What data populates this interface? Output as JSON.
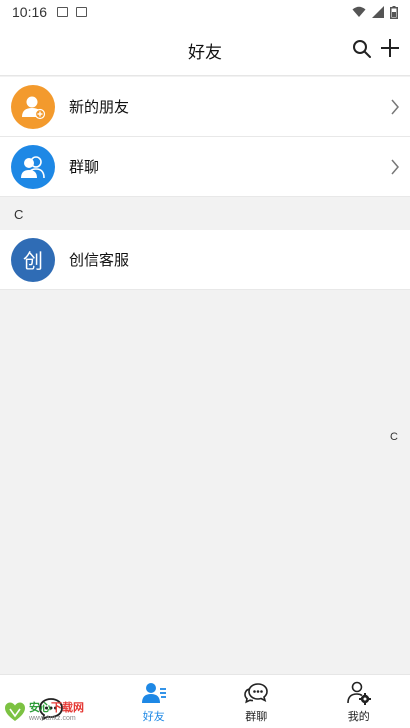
{
  "status_bar": {
    "time": "10:16"
  },
  "header": {
    "title": "好友"
  },
  "rows": [
    {
      "label": "新的朋友",
      "icon": "person-add-icon",
      "color": "#f39a2d"
    },
    {
      "label": "群聊",
      "icon": "group-icon",
      "color": "#1e88e5"
    }
  ],
  "section_letter": "C",
  "contacts": [
    {
      "avatar_text": "创",
      "name": "创信客服",
      "color": "#2f6cb5"
    }
  ],
  "index_letter": "C",
  "tabs": [
    {
      "label": "",
      "icon": "chat-bubble-icon",
      "active": false
    },
    {
      "label": "好友",
      "icon": "contacts-icon",
      "active": true
    },
    {
      "label": "群聊",
      "icon": "group-chat-icon",
      "active": false
    },
    {
      "label": "我的",
      "icon": "profile-settings-icon",
      "active": false
    }
  ],
  "watermark": {
    "brand_green": "安心",
    "brand_red": "下载网",
    "url": "www.anxz.com"
  },
  "colors": {
    "accent": "#1e88e5"
  }
}
